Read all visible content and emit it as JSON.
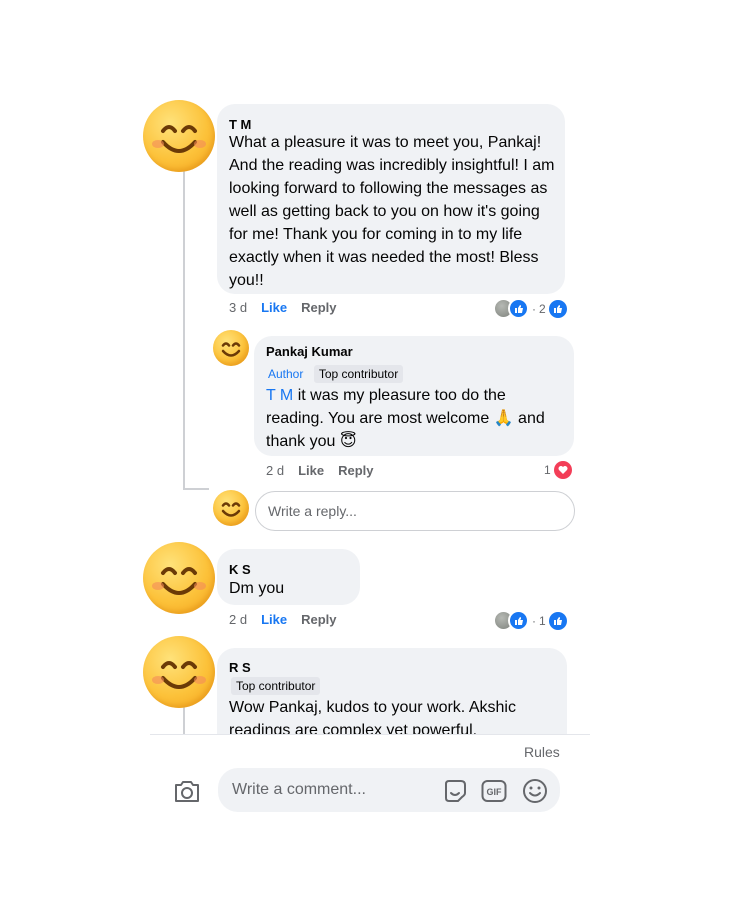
{
  "comments": [
    {
      "author_initials": "T M",
      "text": "What a pleasure it was to meet you, Pankaj!  And the reading was incredibly insightful!  I am looking forward to following the messages as well as getting back to you on how it's going for me!  Thank you for coming in to my life exactly when it was needed the most!  Bless you!!",
      "time": "3 d",
      "like_label": "Like",
      "reply_label": "Reply",
      "reaction_count": "2",
      "reaction_sep": "·",
      "reply": {
        "author": "Pankaj Kumar",
        "author_tag": "Author",
        "badge": "Top contributor",
        "mention": "T M",
        "text": "it was my pleasure too do the reading. You are most welcome 🙏 and thank you 😇",
        "time": "2 d",
        "like_label": "Like",
        "reply_label": "Reply",
        "reaction_count": "1"
      },
      "write_reply_placeholder": "Write a reply..."
    },
    {
      "author_initials": "K S",
      "text": "Dm you",
      "time": "2 d",
      "like_label": "Like",
      "reply_label": "Reply",
      "reaction_count": "1",
      "reaction_sep": "·"
    },
    {
      "author_initials": "R S",
      "badge": "Top contributor",
      "text": "Wow Pankaj, kudos to your work. Akshic readings are complex yet powerful."
    }
  ],
  "footer": {
    "rules_link": "Rules",
    "comment_placeholder": "Write a comment..."
  },
  "icons": {
    "camera": "camera-icon",
    "sticker": "sticker-icon",
    "gif": "gif-icon",
    "emoji": "emoji-icon"
  },
  "colors": {
    "accent": "#1877f2",
    "bubble": "#f0f2f5",
    "heart": "#f33e58"
  }
}
